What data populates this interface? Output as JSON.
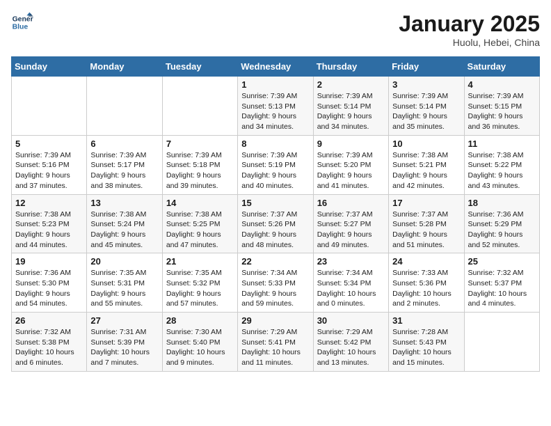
{
  "logo": {
    "line1": "General",
    "line2": "Blue"
  },
  "title": "January 2025",
  "subtitle": "Huolu, Hebei, China",
  "days_header": [
    "Sunday",
    "Monday",
    "Tuesday",
    "Wednesday",
    "Thursday",
    "Friday",
    "Saturday"
  ],
  "weeks": [
    [
      {
        "day": "",
        "info": ""
      },
      {
        "day": "",
        "info": ""
      },
      {
        "day": "",
        "info": ""
      },
      {
        "day": "1",
        "info": "Sunrise: 7:39 AM\nSunset: 5:13 PM\nDaylight: 9 hours\nand 34 minutes."
      },
      {
        "day": "2",
        "info": "Sunrise: 7:39 AM\nSunset: 5:14 PM\nDaylight: 9 hours\nand 34 minutes."
      },
      {
        "day": "3",
        "info": "Sunrise: 7:39 AM\nSunset: 5:14 PM\nDaylight: 9 hours\nand 35 minutes."
      },
      {
        "day": "4",
        "info": "Sunrise: 7:39 AM\nSunset: 5:15 PM\nDaylight: 9 hours\nand 36 minutes."
      }
    ],
    [
      {
        "day": "5",
        "info": "Sunrise: 7:39 AM\nSunset: 5:16 PM\nDaylight: 9 hours\nand 37 minutes."
      },
      {
        "day": "6",
        "info": "Sunrise: 7:39 AM\nSunset: 5:17 PM\nDaylight: 9 hours\nand 38 minutes."
      },
      {
        "day": "7",
        "info": "Sunrise: 7:39 AM\nSunset: 5:18 PM\nDaylight: 9 hours\nand 39 minutes."
      },
      {
        "day": "8",
        "info": "Sunrise: 7:39 AM\nSunset: 5:19 PM\nDaylight: 9 hours\nand 40 minutes."
      },
      {
        "day": "9",
        "info": "Sunrise: 7:39 AM\nSunset: 5:20 PM\nDaylight: 9 hours\nand 41 minutes."
      },
      {
        "day": "10",
        "info": "Sunrise: 7:38 AM\nSunset: 5:21 PM\nDaylight: 9 hours\nand 42 minutes."
      },
      {
        "day": "11",
        "info": "Sunrise: 7:38 AM\nSunset: 5:22 PM\nDaylight: 9 hours\nand 43 minutes."
      }
    ],
    [
      {
        "day": "12",
        "info": "Sunrise: 7:38 AM\nSunset: 5:23 PM\nDaylight: 9 hours\nand 44 minutes."
      },
      {
        "day": "13",
        "info": "Sunrise: 7:38 AM\nSunset: 5:24 PM\nDaylight: 9 hours\nand 45 minutes."
      },
      {
        "day": "14",
        "info": "Sunrise: 7:38 AM\nSunset: 5:25 PM\nDaylight: 9 hours\nand 47 minutes."
      },
      {
        "day": "15",
        "info": "Sunrise: 7:37 AM\nSunset: 5:26 PM\nDaylight: 9 hours\nand 48 minutes."
      },
      {
        "day": "16",
        "info": "Sunrise: 7:37 AM\nSunset: 5:27 PM\nDaylight: 9 hours\nand 49 minutes."
      },
      {
        "day": "17",
        "info": "Sunrise: 7:37 AM\nSunset: 5:28 PM\nDaylight: 9 hours\nand 51 minutes."
      },
      {
        "day": "18",
        "info": "Sunrise: 7:36 AM\nSunset: 5:29 PM\nDaylight: 9 hours\nand 52 minutes."
      }
    ],
    [
      {
        "day": "19",
        "info": "Sunrise: 7:36 AM\nSunset: 5:30 PM\nDaylight: 9 hours\nand 54 minutes."
      },
      {
        "day": "20",
        "info": "Sunrise: 7:35 AM\nSunset: 5:31 PM\nDaylight: 9 hours\nand 55 minutes."
      },
      {
        "day": "21",
        "info": "Sunrise: 7:35 AM\nSunset: 5:32 PM\nDaylight: 9 hours\nand 57 minutes."
      },
      {
        "day": "22",
        "info": "Sunrise: 7:34 AM\nSunset: 5:33 PM\nDaylight: 9 hours\nand 59 minutes."
      },
      {
        "day": "23",
        "info": "Sunrise: 7:34 AM\nSunset: 5:34 PM\nDaylight: 10 hours\nand 0 minutes."
      },
      {
        "day": "24",
        "info": "Sunrise: 7:33 AM\nSunset: 5:36 PM\nDaylight: 10 hours\nand 2 minutes."
      },
      {
        "day": "25",
        "info": "Sunrise: 7:32 AM\nSunset: 5:37 PM\nDaylight: 10 hours\nand 4 minutes."
      }
    ],
    [
      {
        "day": "26",
        "info": "Sunrise: 7:32 AM\nSunset: 5:38 PM\nDaylight: 10 hours\nand 6 minutes."
      },
      {
        "day": "27",
        "info": "Sunrise: 7:31 AM\nSunset: 5:39 PM\nDaylight: 10 hours\nand 7 minutes."
      },
      {
        "day": "28",
        "info": "Sunrise: 7:30 AM\nSunset: 5:40 PM\nDaylight: 10 hours\nand 9 minutes."
      },
      {
        "day": "29",
        "info": "Sunrise: 7:29 AM\nSunset: 5:41 PM\nDaylight: 10 hours\nand 11 minutes."
      },
      {
        "day": "30",
        "info": "Sunrise: 7:29 AM\nSunset: 5:42 PM\nDaylight: 10 hours\nand 13 minutes."
      },
      {
        "day": "31",
        "info": "Sunrise: 7:28 AM\nSunset: 5:43 PM\nDaylight: 10 hours\nand 15 minutes."
      },
      {
        "day": "",
        "info": ""
      }
    ]
  ]
}
